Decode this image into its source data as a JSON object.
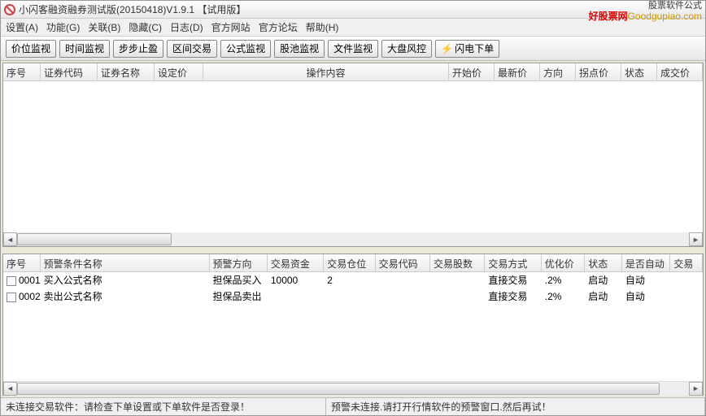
{
  "titlebar": {
    "title": "小闪客融资融券测试版(20150418)V1.9.1 【试用版】",
    "brand_sub": "股票软件公式",
    "brand_red": "好股票网",
    "brand_url": "Goodgupiao.com"
  },
  "menu": [
    "设置(A)",
    "功能(G)",
    "关联(B)",
    "隐藏(C)",
    "日志(D)",
    "官方网站",
    "官方论坛",
    "帮助(H)"
  ],
  "toolbar": [
    "价位监视",
    "时间监视",
    "步步止盈",
    "区间交易",
    "公式监视",
    "股池监视",
    "文件监视",
    "大盘风控",
    "闪电下单"
  ],
  "top_cols": [
    "序号",
    "证券代码",
    "证券名称",
    "设定价",
    "操作内容",
    "开始价",
    "最新价",
    "方向",
    "拐点价",
    "状态",
    "成交价"
  ],
  "bottom_cols": [
    "序号",
    "预警条件名称",
    "预警方向",
    "交易资金",
    "交易仓位",
    "交易代码",
    "交易股数",
    "交易方式",
    "优化价",
    "状态",
    "是否自动",
    "交易"
  ],
  "bottom_rows": [
    {
      "seq": "0001",
      "name": "买入公式名称",
      "dir": "担保品买入",
      "fund": "10000",
      "pos": "2",
      "code": "",
      "qty": "",
      "mode": "直接交易",
      "opt": ".2%",
      "stat": "启动",
      "auto": "自动",
      "tr": ""
    },
    {
      "seq": "0002",
      "name": "卖出公式名称",
      "dir": "担保品卖出",
      "fund": "",
      "pos": "",
      "code": "",
      "qty": "",
      "mode": "直接交易",
      "opt": ".2%",
      "stat": "启动",
      "auto": "自动",
      "tr": ""
    }
  ],
  "status": {
    "left": "未连接交易软件：请检查下单设置或下单软件是否登录！",
    "right": "预警未连接.请打开行情软件的预警窗口.然后再试！"
  }
}
